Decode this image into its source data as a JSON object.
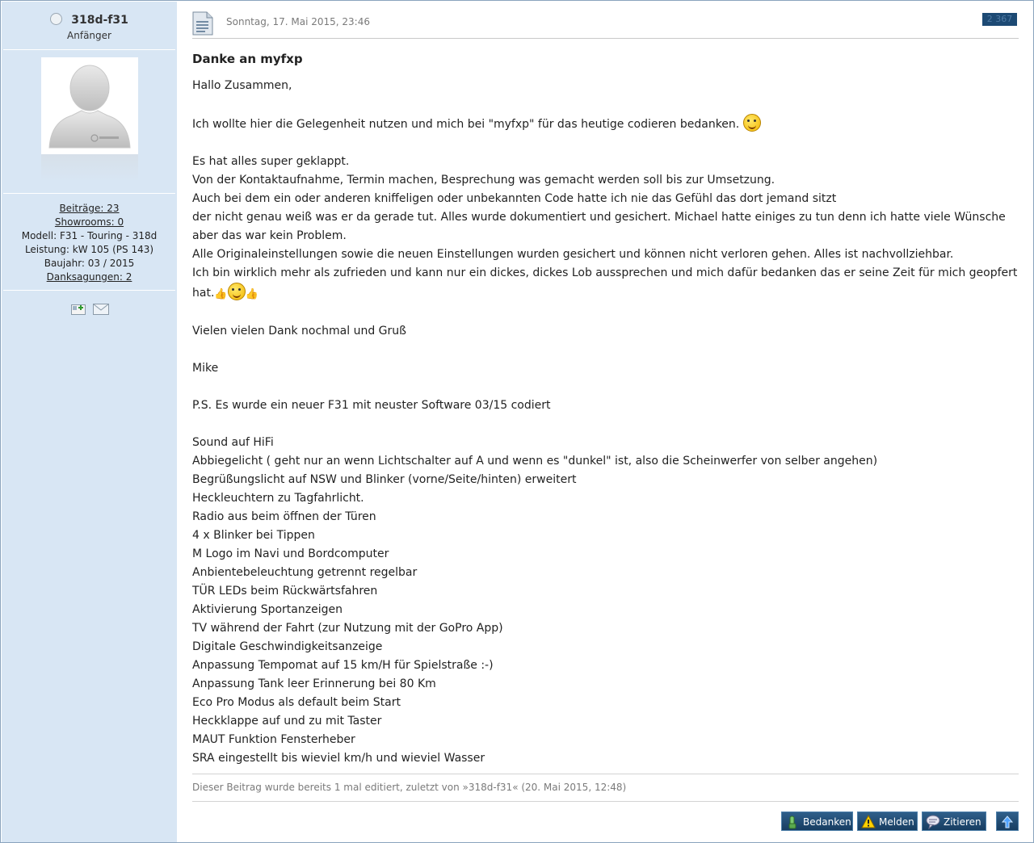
{
  "author": {
    "name": "318d-f31",
    "rank": "Anfänger",
    "stats": {
      "posts": "Beiträge: 23",
      "showrooms": "Showrooms: 0",
      "model": "Modell: F31 - Touring - 318d",
      "power": "Leistung: kW 105 (PS 143)",
      "year": "Baujahr: 03 / 2015",
      "thanks": "Danksagungen: 2"
    }
  },
  "post": {
    "date": "Sonntag, 17. Mai 2015, 23:46",
    "number": "2 367",
    "title": "Danke an myfxp",
    "lines": {
      "l1": "Hallo Zusammen,",
      "l2": "Ich wollte hier die Gelegenheit nutzen und mich bei \"myfxp\" für das heutige codieren bedanken.",
      "l3": "Es hat alles super geklappt.",
      "l4": "Von der Kontaktaufnahme, Termin machen, Besprechung was gemacht werden soll bis zur Umsetzung.",
      "l5": "Auch bei dem ein oder anderen kniffeligen oder unbekannten Code hatte ich nie das Gefühl das dort jemand sitzt",
      "l6": "der nicht genau weiß was er da gerade tut. Alles wurde dokumentiert und gesichert. Michael hatte einiges zu tun denn ich hatte viele Wünsche",
      "l7": "aber das war kein Problem.",
      "l8": "Alle Originaleinstellungen sowie die neuen Einstellungen wurden gesichert und können nicht verloren gehen. Alles ist nachvollziehbar.",
      "l9": "Ich bin wirklich mehr als zufrieden und kann nur ein dickes, dickes Lob aussprechen und mich dafür bedanken das er seine Zeit für mich geopfert",
      "l10": "hat.",
      "l11": "Vielen vielen Dank nochmal und Gruß",
      "l12": "Mike",
      "l13": "P.S. Es wurde ein neuer F31 mit neuster Software 03/15 codiert"
    },
    "features": [
      "Sound auf HiFi",
      "Abbiegelicht ( geht nur an wenn Lichtschalter auf A und wenn es \"dunkel\" ist, also die Scheinwerfer von selber angehen)",
      "Begrüßungslicht auf NSW und Blinker (vorne/Seite/hinten) erweitert",
      "Heckleuchtern zu Tagfahrlicht.",
      "Radio aus beim öffnen der Türen",
      "4 x Blinker bei Tippen",
      "M Logo im Navi und Bordcomputer",
      "Anbientebeleuchtung getrennt regelbar",
      "TÜR LEDs beim Rückwärtsfahren",
      "Aktivierung Sportanzeigen",
      "TV während der Fahrt (zur Nutzung mit der GoPro App)",
      "Digitale Geschwindigkeitsanzeige",
      "Anpassung Tempomat auf 15 km/H für Spielstraße :-)",
      "Anpassung Tank leer Erinnerung bei 80 Km",
      "Eco Pro Modus als default beim Start",
      "Heckklappe auf und zu mit Taster",
      "MAUT Funktion Fensterheber",
      "SRA eingestellt bis wieviel km/h und wieviel Wasser"
    ],
    "edit_note": "Dieser Beitrag wurde bereits 1 mal editiert, zuletzt von »318d-f31« (20. Mai 2015, 12:48)"
  },
  "actions": {
    "thank": "Bedanken",
    "report": "Melden",
    "quote": "Zitieren"
  },
  "colors": {
    "sidebar_bg": "#d8e6f4",
    "button_bg": "#1d4a74"
  }
}
